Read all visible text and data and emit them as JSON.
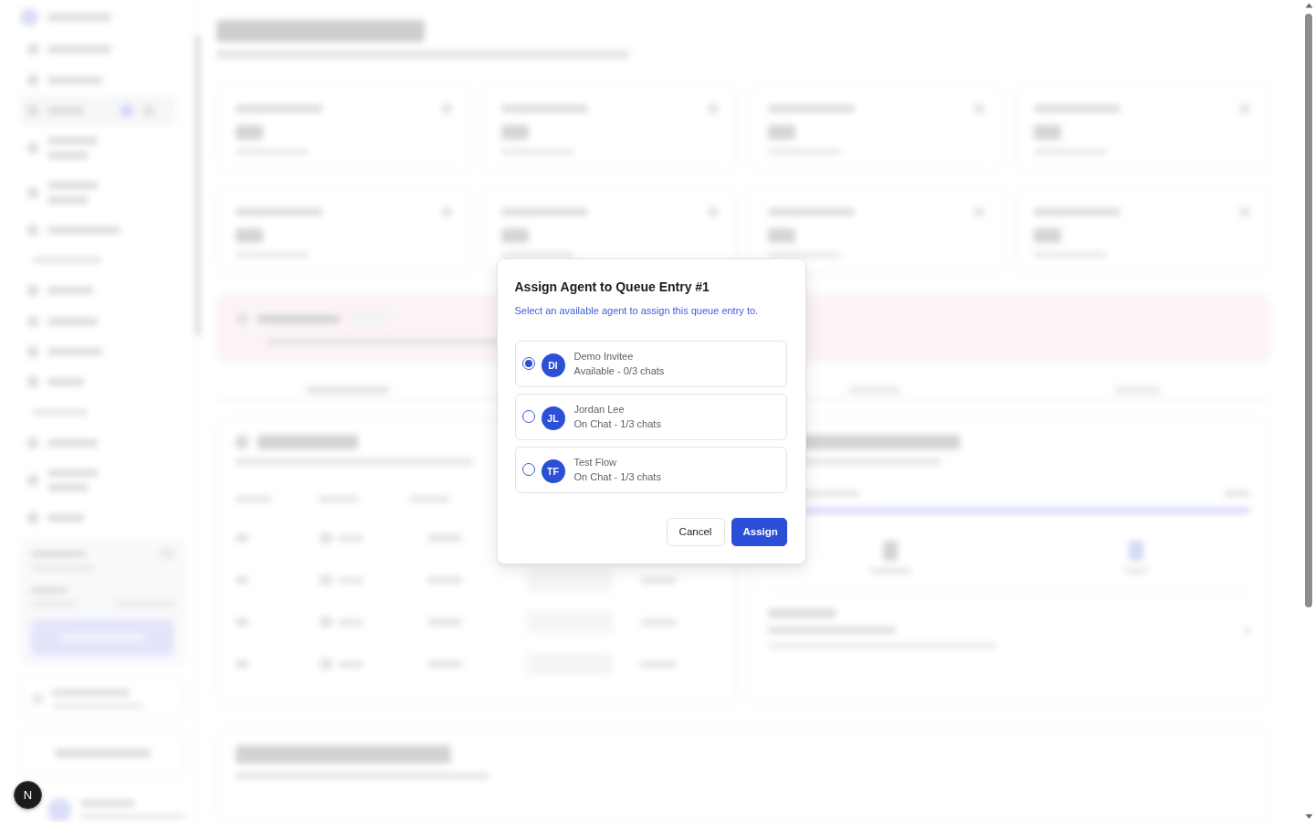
{
  "dialog": {
    "title": "Assign Agent to Queue Entry #1",
    "description": "Select an available agent to assign this queue entry to.",
    "agents": [
      {
        "initials": "DI",
        "name": "Demo Invitee",
        "status": "Available - 0/3 chats",
        "selected": true
      },
      {
        "initials": "JL",
        "name": "Jordan Lee",
        "status": "On Chat - 1/3 chats",
        "selected": false
      },
      {
        "initials": "TF",
        "name": "Test Flow",
        "status": "On Chat - 1/3 chats",
        "selected": false
      }
    ],
    "buttons": [
      {
        "label": "Cancel",
        "kind": "secondary"
      },
      {
        "label": "Assign",
        "kind": "primary"
      }
    ]
  },
  "dev_badge": {
    "label": "N"
  }
}
